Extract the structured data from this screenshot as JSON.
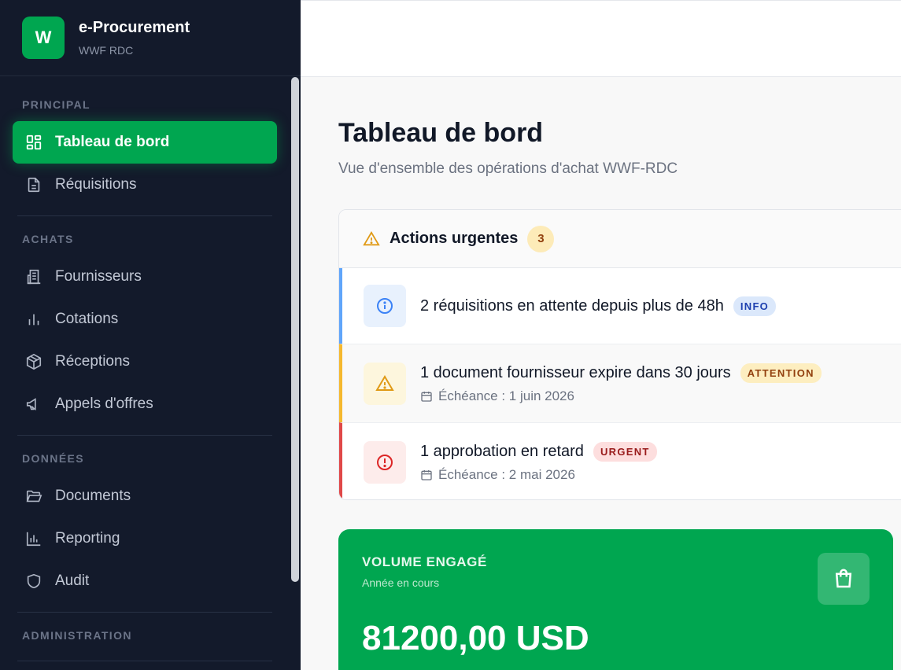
{
  "brand": {
    "logo_letter": "W",
    "title": "e-Procurement",
    "subtitle": "WWF RDC"
  },
  "sidebar": {
    "sections": {
      "principal": "PRINCIPAL",
      "achats": "ACHATS",
      "donnees": "DONNÉES",
      "administration": "ADMINISTRATION"
    },
    "items": {
      "dashboard": "Tableau de bord",
      "requisitions": "Réquisitions",
      "suppliers": "Fournisseurs",
      "quotations": "Cotations",
      "receptions": "Réceptions",
      "tenders": "Appels d'offres",
      "documents": "Documents",
      "reporting": "Reporting",
      "audit": "Audit"
    },
    "active_item": "dashboard"
  },
  "main": {
    "title": "Tableau de bord",
    "subtitle": "Vue d'ensemble des opérations d'achat WWF-RDC"
  },
  "urgent": {
    "title": "Actions urgentes",
    "count": "3",
    "alerts": [
      {
        "text": "2 réquisitions en attente depuis plus de 48h",
        "tag": "INFO",
        "level": "info"
      },
      {
        "text": "1 document fournisseur expire dans 30 jours",
        "tag": "ATTENTION",
        "level": "warning",
        "date": "Échéance : 1 juin 2026"
      },
      {
        "text": "1 approbation en retard",
        "tag": "URGENT",
        "level": "urgent",
        "date": "Échéance : 2 mai 2026"
      }
    ]
  },
  "volume": {
    "title": "VOLUME ENGAGÉ",
    "subtitle": "Année en cours",
    "value": "81200,00 USD",
    "icon": "shopping-bag-icon"
  },
  "colors": {
    "sidebar_bg": "#131a2b",
    "accent_green": "#00a650",
    "info_blue": "#60a5fa",
    "warning_amber": "#f5b82e",
    "urgent_red": "#e04848"
  }
}
